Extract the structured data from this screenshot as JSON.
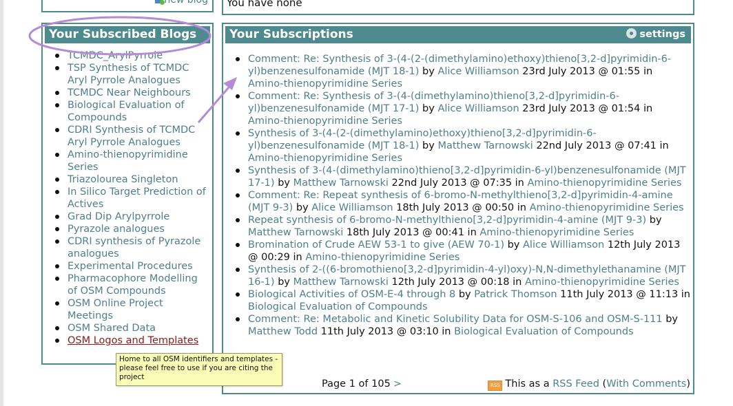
{
  "top": {
    "new_blog_label": "new blog",
    "none_text": "You have none"
  },
  "blogs": {
    "title": "Your Subscribed Blogs",
    "items": [
      {
        "label": "TCMDC_ArylPyrrole"
      },
      {
        "label": "TSP Synthesis of TCMDC Aryl Pyrrole Analogues"
      },
      {
        "label": "TCMDC Near Neighbours"
      },
      {
        "label": "Biological Evaluation of Compounds"
      },
      {
        "label": "CDRI Synthesis of TCMDC Aryl Pyrrole Analogues"
      },
      {
        "label": "Amino-thienopyrimidine Series"
      },
      {
        "label": "Triazolourea Singleton"
      },
      {
        "label": "In Silico Target Prediction of Actives"
      },
      {
        "label": "Grad Dip Arylpyrrole"
      },
      {
        "label": "Pyrazole analogues"
      },
      {
        "label": "CDRI synthesis of Pyrazole analogues"
      },
      {
        "label": "Experimental Procedures"
      },
      {
        "label": "Pharmacophore Modelling of OSM Compounds"
      },
      {
        "label": "OSM Online Project Meetings"
      },
      {
        "label": "OSM Shared Data"
      },
      {
        "label": "OSM Logos and Templates"
      }
    ]
  },
  "subs": {
    "title": "Your Subscriptions",
    "settings_label": "settings",
    "items": [
      {
        "title": "Comment: Re: Synthesis of 3-(4-(2-(dimethylamino)ethoxy)thieno[3,2-d]pyrimidin-6-yl)benzenesulfonamide (MJT 18-1)",
        "by": "by",
        "author": "Alice Williamson",
        "date": "23rd July 2013 @ 01:55",
        "in": "in",
        "blog": "Amino-thienopyrimidine Series"
      },
      {
        "title": "Comment: Re: Synthesis of 3-(4-(dimethylamino)thieno[3,2-d]pyrimidin-6-yl)benzenesulfonamide (MJT 17-1)",
        "by": "by",
        "author": "Alice Williamson",
        "date": "23rd July 2013 @ 01:54",
        "in": "in",
        "blog": "Amino-thienopyrimidine Series"
      },
      {
        "title": "Synthesis of 3-(4-(2-(dimethylamino)ethoxy)thieno[3,2-d]pyrimidin-6-yl)benzenesulfonamide (MJT 18-1)",
        "by": "by",
        "author": "Matthew Tarnowski",
        "date": "22nd July 2013 @ 07:41",
        "in": "in",
        "blog": "Amino-thienopyrimidine Series"
      },
      {
        "title": "Synthesis of 3-(4-(dimethylamino)thieno[3,2-d]pyrimidin-6-yl)benzenesulfonamide (MJT 17-1)",
        "by": "by",
        "author": "Matthew Tarnowski",
        "date": "22nd July 2013 @ 07:35",
        "in": "in",
        "blog": "Amino-thienopyrimidine Series"
      },
      {
        "title": "Comment: Re: Repeat synthesis of 6-bromo-N-methylthieno[3,2-d]pyrimidin-4-amine (MJT 9-3)",
        "by": "by",
        "author": "Alice Williamson",
        "date": "18th July 2013 @ 00:50",
        "in": "in",
        "blog": "Amino-thienopyrimidine Series"
      },
      {
        "title": "Repeat synthesis of 6-bromo-N-methylthieno[3,2-d]pyrimidin-4-amine (MJT 9-3)",
        "by": "by",
        "author": "Matthew Tarnowski",
        "date": "18th July 2013 @ 00:41",
        "in": "in",
        "blog": "Amino-thienopyrimidine Series"
      },
      {
        "title": "Bromination of Crude AEW 53-1 to give (AEW 70-1)",
        "by": "by",
        "author": "Alice Williamson",
        "date": "12th July 2013 @ 00:29",
        "in": "in",
        "blog": "Amino-thienopyrimidine Series"
      },
      {
        "title": "Synthesis of 2-((6-bromothieno[3,2-d]pyrimidin-4-yl)oxy)-N,N-dimethylethanamine (MJT 16-1)",
        "by": "by",
        "author": "Matthew Tarnowski",
        "date": "12th July 2013 @ 00:18",
        "in": "in",
        "blog": "Amino-thienopyrimidine Series"
      },
      {
        "title": "Biological Activities of OSM-E-4 through 8",
        "by": "by",
        "author": "Patrick Thomson",
        "date": "11th July 2013 @ 11:13",
        "in": "in",
        "blog": "Biological Evaluation of Compounds"
      },
      {
        "title": "Comment: Re: Metabolic and Kinetic Solubility Data for OSM-S-106 and OSM-S-111",
        "by": "by",
        "author": "Matthew Todd",
        "date": "11th July 2013 @ 03:10",
        "in": "in",
        "blog": "Biological Evaluation of Compounds"
      }
    ],
    "pager": {
      "text": "Page 1 of 105",
      "next_label": ">"
    },
    "rss": {
      "icon_text": "RSS",
      "text": "This as a",
      "link_label": "RSS Feed",
      "open_paren": "(",
      "comments_label": "With Comments",
      "close_paren": ")"
    }
  },
  "tooltip": {
    "text": "Home to all OSM identifiers and templates - please feel free to use if you are citing the project"
  },
  "colors": {
    "accent": "#4d8a8e",
    "link": "#4f7f8a",
    "visited_link": "#8b1a1a",
    "annotation": "#b58ad6",
    "tooltip_bg": "#fbfcb8"
  }
}
